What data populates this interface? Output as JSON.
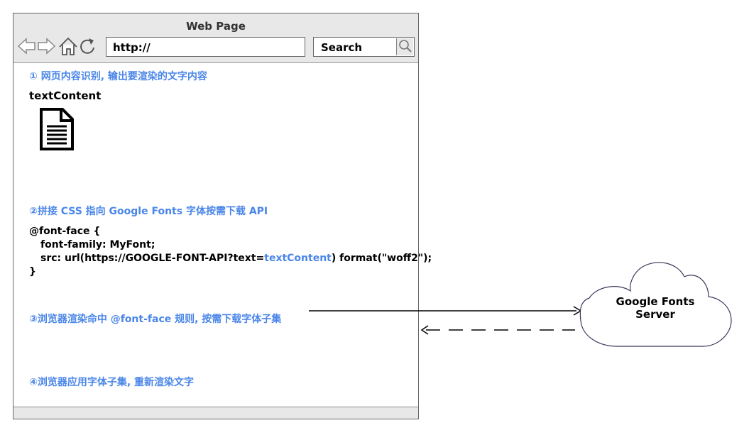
{
  "browser": {
    "title": "Web Page",
    "url": "http://",
    "search_label": "Search"
  },
  "steps": {
    "step1": "① 网页内容识别, 输出要渲染的文字内容",
    "step2": "②拼接 CSS 指向 Google Fonts 字体按需下载 API",
    "step3": "③浏览器渲染命中 @font-face 规则, 按需下载字体子集",
    "step4": "④浏览器应用字体子集, 重新渲染文字"
  },
  "content_label": "textContent",
  "code": {
    "line1": "@font-face {",
    "line2": "font-family: MyFont;",
    "line3_prefix": "src: url(https://GOOGLE-FONT-API?text=",
    "line3_var": "textContent",
    "line3_suffix": ") format(\"woff2\");",
    "line4": "}"
  },
  "server_label": "Google Fonts Server",
  "icons": {
    "back": "back-arrow-icon",
    "forward": "forward-arrow-icon",
    "home": "home-icon",
    "refresh": "refresh-icon",
    "search": "magnifier-icon",
    "document": "document-icon",
    "cloud": "cloud-icon"
  },
  "colors": {
    "accent_blue": "#4a86e8",
    "chrome_gray": "#e8e8e8"
  }
}
